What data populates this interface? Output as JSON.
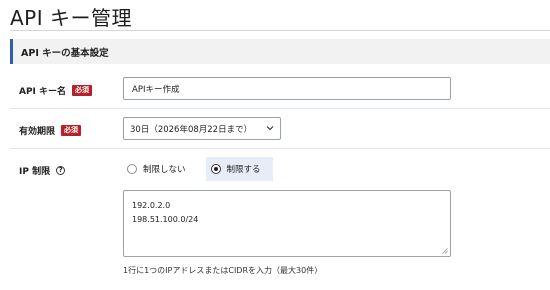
{
  "page": {
    "title": "API キー管理"
  },
  "section": {
    "title": "API キーの基本設定"
  },
  "fields": {
    "name": {
      "label": "API キー名",
      "badge": "必須",
      "value": "APIキー作成"
    },
    "expiry": {
      "label": "有効期限",
      "badge": "必須",
      "selected": "30日（2026年08月22日まで）"
    },
    "ip": {
      "label": "IP 制限",
      "help_icon": "?",
      "options": [
        "制限しない",
        "制限する"
      ],
      "selected_option": "制限する",
      "cidr_lines": [
        "192.0.2.0",
        "198.51.100.0/24"
      ],
      "hint": "1行に1つのIPアドレスまたはCIDRを入力（最大30件）"
    }
  },
  "colors": {
    "accent": "#2f5fa8",
    "required_badge": "#b5202b",
    "selected_bg": "#e6edf7"
  },
  "icons": {
    "select": "chevron-down-icon",
    "help": "help-icon"
  }
}
